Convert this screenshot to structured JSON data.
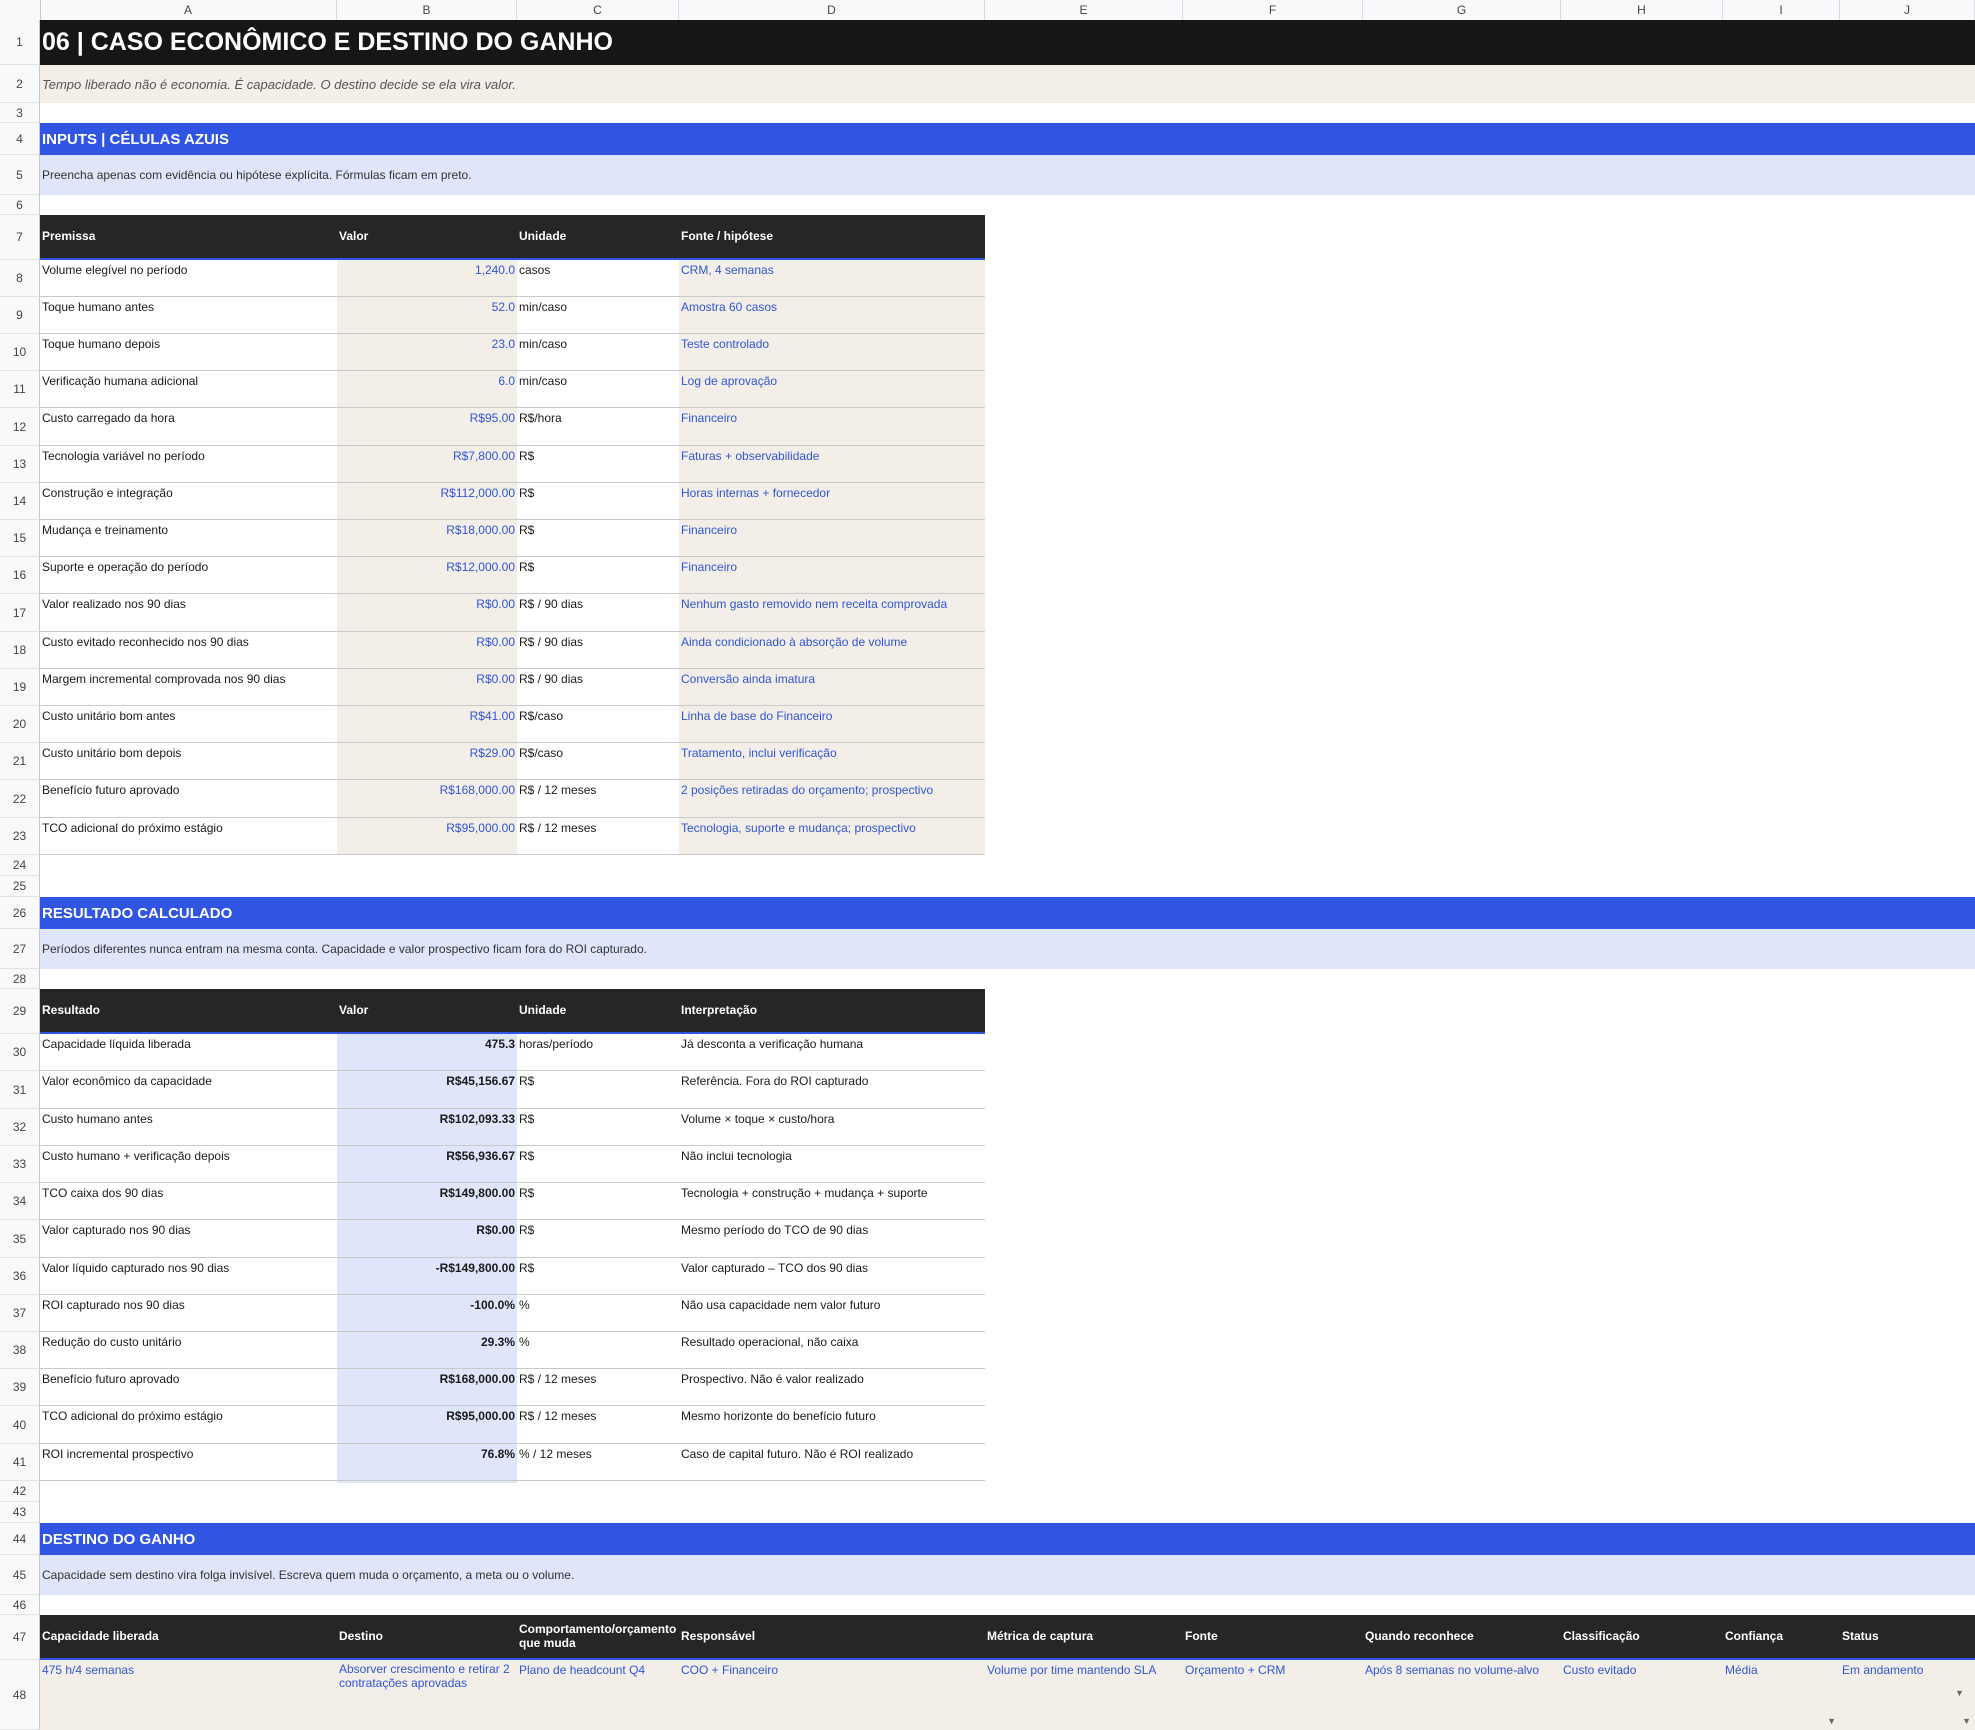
{
  "columns": [
    "A",
    "B",
    "C",
    "D",
    "E",
    "F",
    "G",
    "H",
    "I",
    "J"
  ],
  "row_numbers": [
    "1",
    "2",
    "3",
    "4",
    "5",
    "6",
    "7",
    "8",
    "9",
    "10",
    "11",
    "12",
    "13",
    "14",
    "15",
    "16",
    "17",
    "18",
    "19",
    "20",
    "21",
    "22",
    "23",
    "24",
    "25",
    "26",
    "27",
    "28",
    "29",
    "30",
    "31",
    "32",
    "33",
    "34",
    "35",
    "36",
    "37",
    "38",
    "39",
    "40",
    "41",
    "42",
    "43",
    "44",
    "45",
    "46",
    "47",
    "48"
  ],
  "title": "06 | CASO ECONÔMICO E DESTINO DO GANHO",
  "subtitle": "Tempo liberado não é economia. É capacidade. O destino decide se ela vira valor.",
  "inputs": {
    "heading": "INPUTS | CÉLULAS AZUIS",
    "note": "Preencha apenas com evidência ou hipótese explícita. Fórmulas ficam em preto.",
    "headers": [
      "Premissa",
      "Valor",
      "Unidade",
      "Fonte / hipótese"
    ],
    "rows": [
      {
        "premissa": "Volume elegível no período",
        "valor": "1,240.0",
        "unidade": "casos",
        "fonte": "CRM, 4 semanas"
      },
      {
        "premissa": "Toque humano antes",
        "valor": "52.0",
        "unidade": "min/caso",
        "fonte": "Amostra 60 casos"
      },
      {
        "premissa": "Toque humano depois",
        "valor": "23.0",
        "unidade": "min/caso",
        "fonte": "Teste controlado"
      },
      {
        "premissa": "Verificação humana adicional",
        "valor": "6.0",
        "unidade": "min/caso",
        "fonte": "Log de aprovação"
      },
      {
        "premissa": "Custo carregado da hora",
        "valor": "R$95.00",
        "unidade": "R$/hora",
        "fonte": "Financeiro"
      },
      {
        "premissa": "Tecnologia variável no período",
        "valor": "R$7,800.00",
        "unidade": "R$",
        "fonte": "Faturas + observabilidade"
      },
      {
        "premissa": "Construção e integração",
        "valor": "R$112,000.00",
        "unidade": "R$",
        "fonte": "Horas internas + fornecedor"
      },
      {
        "premissa": "Mudança e treinamento",
        "valor": "R$18,000.00",
        "unidade": "R$",
        "fonte": "Financeiro"
      },
      {
        "premissa": "Suporte e operação do período",
        "valor": "R$12,000.00",
        "unidade": "R$",
        "fonte": "Financeiro"
      },
      {
        "premissa": "Valor realizado nos 90 dias",
        "valor": "R$0.00",
        "unidade": "R$ / 90 dias",
        "fonte": "Nenhum gasto removido nem receita comprovada"
      },
      {
        "premissa": "Custo evitado reconhecido nos 90 dias",
        "valor": "R$0.00",
        "unidade": "R$ / 90 dias",
        "fonte": "Ainda condicionado à absorção de volume"
      },
      {
        "premissa": "Margem incremental comprovada nos 90 dias",
        "valor": "R$0.00",
        "unidade": "R$ / 90 dias",
        "fonte": "Conversão ainda imatura"
      },
      {
        "premissa": "Custo unitário bom antes",
        "valor": "R$41.00",
        "unidade": "R$/caso",
        "fonte": "Linha de base do Financeiro"
      },
      {
        "premissa": "Custo unitário bom depois",
        "valor": "R$29.00",
        "unidade": "R$/caso",
        "fonte": "Tratamento, inclui verificação"
      },
      {
        "premissa": "Benefício futuro aprovado",
        "valor": "R$168,000.00",
        "unidade": "R$ / 12 meses",
        "fonte": "2 posições retiradas do orçamento; prospectivo"
      },
      {
        "premissa": "TCO adicional do próximo estágio",
        "valor": "R$95,000.00",
        "unidade": "R$ / 12 meses",
        "fonte": "Tecnologia, suporte e mudança; prospectivo"
      }
    ]
  },
  "results": {
    "heading": "RESULTADO CALCULADO",
    "note": "Períodos diferentes nunca entram na mesma conta. Capacidade e valor prospectivo ficam fora do ROI capturado.",
    "headers": [
      "Resultado",
      "Valor",
      "Unidade",
      "Interpretação"
    ],
    "rows": [
      {
        "resultado": "Capacidade líquida liberada",
        "valor": "475.3",
        "unidade": "horas/período",
        "interp": "Já desconta a verificação humana"
      },
      {
        "resultado": "Valor econômico da capacidade",
        "valor": "R$45,156.67",
        "unidade": "R$",
        "interp": "Referência. Fora do ROI capturado"
      },
      {
        "resultado": "Custo humano antes",
        "valor": "R$102,093.33",
        "unidade": "R$",
        "interp": "Volume × toque × custo/hora"
      },
      {
        "resultado": "Custo humano + verificação depois",
        "valor": "R$56,936.67",
        "unidade": "R$",
        "interp": "Não inclui tecnologia"
      },
      {
        "resultado": "TCO caixa dos 90 dias",
        "valor": "R$149,800.00",
        "unidade": "R$",
        "interp": "Tecnologia + construção + mudança + suporte"
      },
      {
        "resultado": "Valor capturado nos 90 dias",
        "valor": "R$0.00",
        "unidade": "R$",
        "interp": "Mesmo período do TCO de 90 dias"
      },
      {
        "resultado": "Valor líquido capturado nos 90 dias",
        "valor": "-R$149,800.00",
        "unidade": "R$",
        "interp": "Valor capturado – TCO dos 90 dias"
      },
      {
        "resultado": "ROI capturado nos 90 dias",
        "valor": "-100.0%",
        "unidade": "%",
        "interp": "Não usa capacidade nem valor futuro"
      },
      {
        "resultado": "Redução do custo unitário",
        "valor": "29.3%",
        "unidade": "%",
        "interp": "Resultado operacional, não caixa"
      },
      {
        "resultado": "Benefício futuro aprovado",
        "valor": "R$168,000.00",
        "unidade": "R$ / 12 meses",
        "interp": "Prospectivo. Não é valor realizado"
      },
      {
        "resultado": "TCO adicional do próximo estágio",
        "valor": "R$95,000.00",
        "unidade": "R$ / 12 meses",
        "interp": "Mesmo horizonte do benefício futuro"
      },
      {
        "resultado": "ROI incremental prospectivo",
        "valor": "76.8%",
        "unidade": "% / 12 meses",
        "interp": "Caso de capital futuro. Não é ROI realizado"
      }
    ]
  },
  "destino": {
    "heading": "DESTINO DO GANHO",
    "note": "Capacidade sem destino vira folga invisível. Escreva quem muda o orçamento, a meta ou o volume.",
    "headers": [
      "Capacidade liberada",
      "Destino",
      "Comportamento/orçamento que muda",
      "Responsável",
      "Métrica de captura",
      "Fonte",
      "Quando reconhece",
      "Classificação",
      "Confiança",
      "Status"
    ],
    "row": [
      "475 h/4 semanas",
      "Absorver crescimento e retirar 2 contratações aprovadas",
      "Plano de headcount Q4",
      "COO + Financeiro",
      "Volume por time mantendo SLA",
      "Orçamento + CRM",
      "Após 8 semanas no volume-alvo",
      "Custo evitado",
      "Média",
      "Em andamento"
    ],
    "dropdown_icon": "▼"
  }
}
